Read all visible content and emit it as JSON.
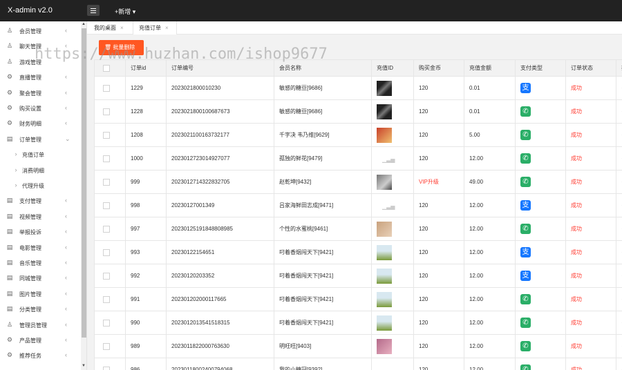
{
  "header": {
    "logo": "X-admin v2.0",
    "add_label": "+新增 ▾"
  },
  "sidebar": {
    "items": [
      {
        "label": "会员管理",
        "icon": "user-icon",
        "sub": false,
        "arrow": "‹"
      },
      {
        "label": "聊天管理",
        "icon": "user-icon",
        "sub": false,
        "arrow": "‹"
      },
      {
        "label": "游戏管理",
        "icon": "user-icon",
        "sub": false,
        "arrow": ""
      },
      {
        "label": "直播管理",
        "icon": "gear-icon",
        "sub": false,
        "arrow": "‹"
      },
      {
        "label": "聚会管理",
        "icon": "gear-icon",
        "sub": false,
        "arrow": "‹"
      },
      {
        "label": "购买设置",
        "icon": "gear-icon",
        "sub": false,
        "arrow": "‹"
      },
      {
        "label": "财务明细",
        "icon": "gear-icon",
        "sub": false,
        "arrow": "‹"
      },
      {
        "label": "订单管理",
        "icon": "document-icon",
        "sub": false,
        "arrow": "⌄"
      },
      {
        "label": "充值订单",
        "icon": "chevron-right-icon",
        "sub": true,
        "arrow": ""
      },
      {
        "label": "消费明细",
        "icon": "chevron-right-icon",
        "sub": true,
        "arrow": ""
      },
      {
        "label": "代理升级",
        "icon": "chevron-right-icon",
        "sub": true,
        "arrow": ""
      },
      {
        "label": "支付管理",
        "icon": "document-icon",
        "sub": false,
        "arrow": "‹"
      },
      {
        "label": "视频管理",
        "icon": "document-icon",
        "sub": false,
        "arrow": "‹"
      },
      {
        "label": "举报投诉",
        "icon": "document-icon",
        "sub": false,
        "arrow": "‹"
      },
      {
        "label": "电影管理",
        "icon": "document-icon",
        "sub": false,
        "arrow": "‹"
      },
      {
        "label": "音乐管理",
        "icon": "document-icon",
        "sub": false,
        "arrow": "‹"
      },
      {
        "label": "同城管理",
        "icon": "document-icon",
        "sub": false,
        "arrow": "‹"
      },
      {
        "label": "图片管理",
        "icon": "document-icon",
        "sub": false,
        "arrow": "‹"
      },
      {
        "label": "分类管理",
        "icon": "document-icon",
        "sub": false,
        "arrow": "‹"
      },
      {
        "label": "管理员管理",
        "icon": "user-icon",
        "sub": false,
        "arrow": "‹"
      },
      {
        "label": "产品管理",
        "icon": "gear-icon",
        "sub": false,
        "arrow": "‹"
      },
      {
        "label": "推荐任务",
        "icon": "gear-icon",
        "sub": false,
        "arrow": "‹"
      }
    ]
  },
  "tabs": [
    {
      "label": "我的桌面",
      "close": "×"
    },
    {
      "label": "充值订单",
      "close": "×"
    }
  ],
  "toolbar": {
    "batch_delete_label": "批量删除",
    "batch_delete_icon": "trash-icon"
  },
  "watermark": "https://www.huzhan.com/ishop9677",
  "table": {
    "headers": [
      "",
      "订单id",
      "订单编号",
      "会员名称",
      "充值ID",
      "购买金币",
      "充值金额",
      "支付类型",
      "订单状态",
      "操"
    ],
    "rows": [
      {
        "id": "1229",
        "no": "2023021800010230",
        "member": "敏感的糖豆[9686]",
        "avatar": "dark",
        "coins": "120",
        "coins_red": false,
        "amount": "0.01",
        "pay": "alipay",
        "status": "成功"
      },
      {
        "id": "1228",
        "no": "2023021800100687673",
        "member": "敏感的糖豆[9686]",
        "avatar": "dark",
        "coins": "120",
        "coins_red": false,
        "amount": "0.01",
        "pay": "wechat",
        "status": "成功"
      },
      {
        "id": "1208",
        "no": "2023021100163732177",
        "member": "千字决 韦乃维[9629]",
        "avatar": "red",
        "coins": "120",
        "coins_red": false,
        "amount": "5.00",
        "pay": "wechat",
        "status": "成功"
      },
      {
        "id": "1000",
        "no": "2023012723014927077",
        "member": "孤独的鲜花[9479]",
        "avatar": "blank",
        "coins": "120",
        "coins_red": false,
        "amount": "12.00",
        "pay": "wechat",
        "status": "成功"
      },
      {
        "id": "999",
        "no": "2023012714322832705",
        "member": "赵乾坤[9432]",
        "avatar": "gray",
        "coins": "VIP升级",
        "coins_red": true,
        "amount": "49.00",
        "pay": "wechat",
        "status": "成功"
      },
      {
        "id": "998",
        "no": "20230127001349",
        "member": "吕家海鲜田志成[9471]",
        "avatar": "blank",
        "coins": "120",
        "coins_red": false,
        "amount": "12.00",
        "pay": "alipay",
        "status": "成功"
      },
      {
        "id": "997",
        "no": "20230125191848808985",
        "member": "个性的水蜜桃[9461]",
        "avatar": "tan",
        "coins": "120",
        "coins_red": false,
        "amount": "12.00",
        "pay": "wechat",
        "status": "成功"
      },
      {
        "id": "993",
        "no": "20230122154651",
        "member": "叼着香烟闯天下[9421]",
        "avatar": "green",
        "coins": "120",
        "coins_red": false,
        "amount": "12.00",
        "pay": "alipay",
        "status": "成功"
      },
      {
        "id": "992",
        "no": "20230120203352",
        "member": "叼着香烟闯天下[9421]",
        "avatar": "green",
        "coins": "120",
        "coins_red": false,
        "amount": "12.00",
        "pay": "alipay",
        "status": "成功"
      },
      {
        "id": "991",
        "no": "202301202000117665",
        "member": "叼着香烟闯天下[9421]",
        "avatar": "green",
        "coins": "120",
        "coins_red": false,
        "amount": "12.00",
        "pay": "wechat",
        "status": "成功"
      },
      {
        "id": "990",
        "no": "2023012013541518315",
        "member": "叼着香烟闯天下[9421]",
        "avatar": "green",
        "coins": "120",
        "coins_red": false,
        "amount": "12.00",
        "pay": "wechat",
        "status": "成功"
      },
      {
        "id": "989",
        "no": "2023011822000763630",
        "member": "明旺旺[9403]",
        "avatar": "pink",
        "coins": "120",
        "coins_red": false,
        "amount": "12.00",
        "pay": "wechat",
        "status": "成功"
      },
      {
        "id": "986",
        "no": "20230118002400794068",
        "member": "我的小糖冠[9392]",
        "avatar": "blank",
        "coins": "120",
        "coins_red": false,
        "amount": "12.00",
        "pay": "wechat",
        "status": "成功"
      }
    ]
  },
  "colors": {
    "accent_button": "#ff5722",
    "status_red": "#ff3b30",
    "alipay": "#1677ff",
    "wechat": "#2aae67",
    "header_bg": "#222222"
  }
}
